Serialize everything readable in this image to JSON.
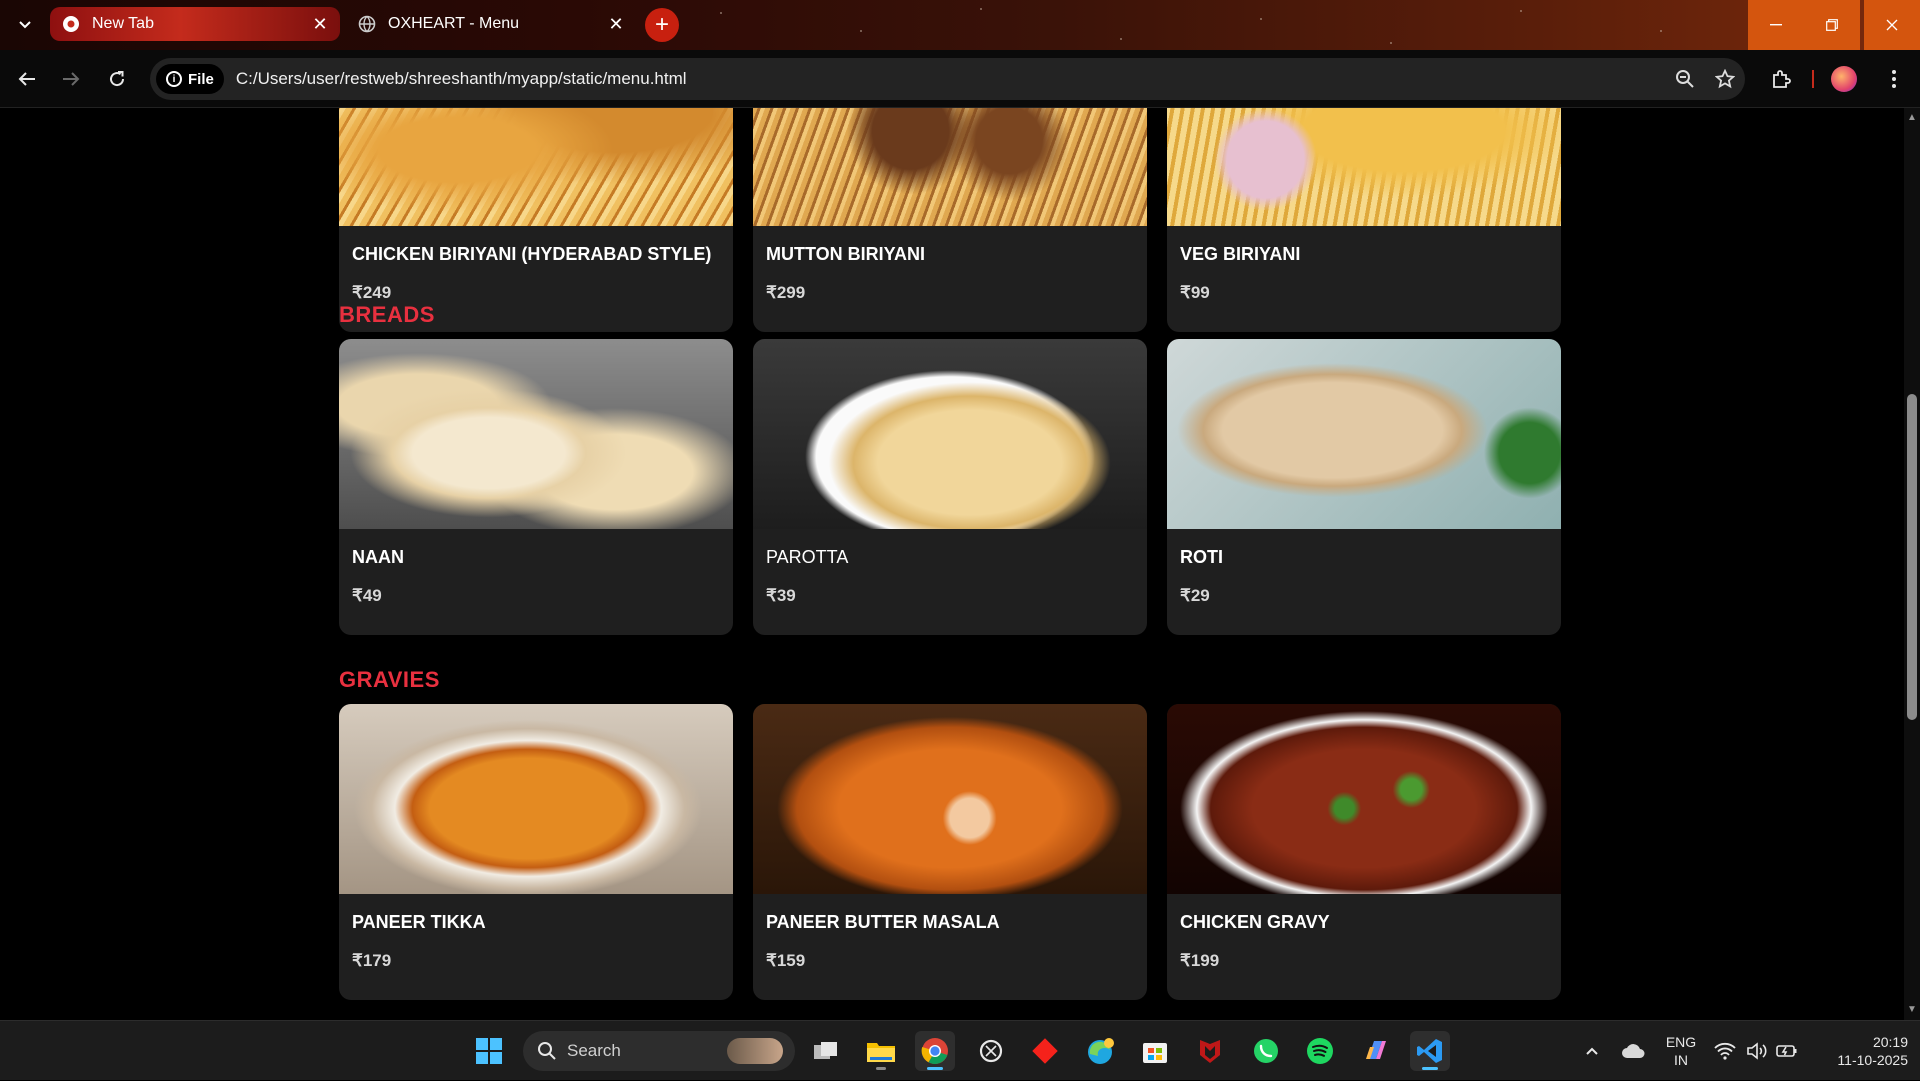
{
  "browser": {
    "tabs": [
      {
        "title": "New Tab",
        "active": true
      },
      {
        "title": "OXHEART - Menu",
        "active": false
      }
    ],
    "site_chip_label": "File",
    "url": "C:/Users/user/restweb/shreeshanth/myapp/static/menu.html"
  },
  "menu": {
    "top_row": [
      {
        "name": "CHICKEN BIRIYANI (HYDERABAD STYLE)",
        "price": "₹249"
      },
      {
        "name": "MUTTON BIRIYANI",
        "price": "₹299"
      },
      {
        "name": "VEG BIRIYANI",
        "price": "₹99"
      }
    ],
    "sections": [
      {
        "title": "BREADS",
        "items": [
          {
            "name": "NAAN",
            "price": "₹49"
          },
          {
            "name": "PAROTTA",
            "price": "₹39"
          },
          {
            "name": "ROTI",
            "price": "₹29"
          }
        ]
      },
      {
        "title": "GRAVIES",
        "items": [
          {
            "name": "PANEER TIKKA",
            "price": "₹179"
          },
          {
            "name": "PANEER BUTTER MASALA",
            "price": "₹159"
          },
          {
            "name": "CHICKEN GRAVY",
            "price": "₹199"
          }
        ]
      }
    ]
  },
  "taskbar": {
    "search_label": "Search",
    "pinned": [
      "task-view-icon",
      "file-explorer-icon",
      "chrome-icon",
      "chatgpt-icon",
      "git-icon",
      "edge-icon",
      "store-icon",
      "mcafee-icon",
      "whatsapp-icon",
      "spotify-icon",
      "copilot-icon",
      "vscode-icon"
    ],
    "language_line1": "ENG",
    "language_line2": "IN",
    "time": "20:19",
    "date": "11-10-2025"
  },
  "colors": {
    "accent": "#e8303f",
    "card_bg": "#1f1f1f",
    "page_bg": "#000000",
    "window_controls": "#d4550e"
  }
}
